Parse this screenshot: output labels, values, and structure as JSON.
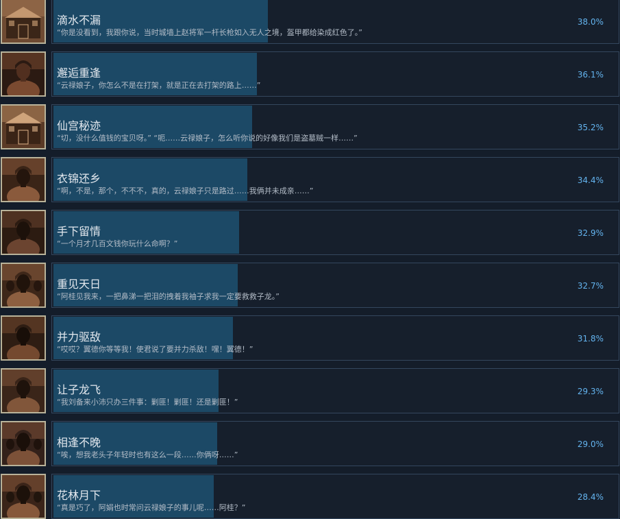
{
  "colors": {
    "background": "#141d2a",
    "panel": "#161f2c",
    "panel_border": "#34475e",
    "progress_fill": "#1c4966",
    "title_text": "#e3e8ee",
    "description_text": "#b3bcc7",
    "percentage_text": "#64b4ef",
    "icon_frame": "#b9b39a"
  },
  "achievements": [
    {
      "icon": "city-gate-scene-icon",
      "title": "滴水不漏",
      "description": "“你是没看到，我跟你说，当时城墙上赵将军一杆长枪如入无人之境，盔甲都给染成红色了。”",
      "percent_label": "38.0%",
      "percent": 38.0
    },
    {
      "icon": "warrior-woman-portrait-icon",
      "title": "邂逅重逢",
      "description": "“云禄娘子，你怎么不是在打架，就是正在去打架的路上……”",
      "percent_label": "36.1%",
      "percent": 36.1
    },
    {
      "icon": "palace-interior-scene-icon",
      "title": "仙宫秘迹",
      "description": "“切，没什么值钱的宝贝呀。” “呃……云禄娘子，怎么听你说的好像我们是盗墓贼一样……”",
      "percent_label": "35.2%",
      "percent": 35.2
    },
    {
      "icon": "young-scholar-portrait-icon",
      "title": "衣锦还乡",
      "description": "“啊，不是，那个，不不不，真的，云禄娘子只是路过……我俩并未成亲……”",
      "percent_label": "34.4%",
      "percent": 34.4
    },
    {
      "icon": "archer-soldier-portrait-icon",
      "title": "手下留情",
      "description": "“一个月才几百文钱你玩什么命啊？”",
      "percent_label": "32.9%",
      "percent": 32.9
    },
    {
      "icon": "group-of-people-scene-icon",
      "title": "重见天日",
      "description": "“阿桂见我来，一把鼻涕一把泪的拽着我袖子求我一定要救救子龙。”",
      "percent_label": "32.7%",
      "percent": 32.7
    },
    {
      "icon": "armored-general-portrait-icon",
      "title": "并力驱敌",
      "description": "“哎哎？翼德你等等我！使君说了要并力杀敌！嘿！翼德！”",
      "percent_label": "31.8%",
      "percent": 31.8
    },
    {
      "icon": "lord-portrait-icon",
      "title": "让子龙飞",
      "description": "“我刘备来小沛只办三件事：剿匪！剿匪！还是剿匪！”",
      "percent_label": "29.3%",
      "percent": 29.3
    },
    {
      "icon": "elder-and-couple-portrait-icon",
      "title": "相逢不晚",
      "description": "“唉，想我老头子年轻时也有这么一段……你俩呀……”",
      "percent_label": "29.0%",
      "percent": 29.0
    },
    {
      "icon": "couple-portrait-icon",
      "title": "花林月下",
      "description": "“真是巧了，阿娟也时常问云禄娘子的事儿呢……阿桂？”",
      "percent_label": "28.4%",
      "percent": 28.4
    }
  ]
}
